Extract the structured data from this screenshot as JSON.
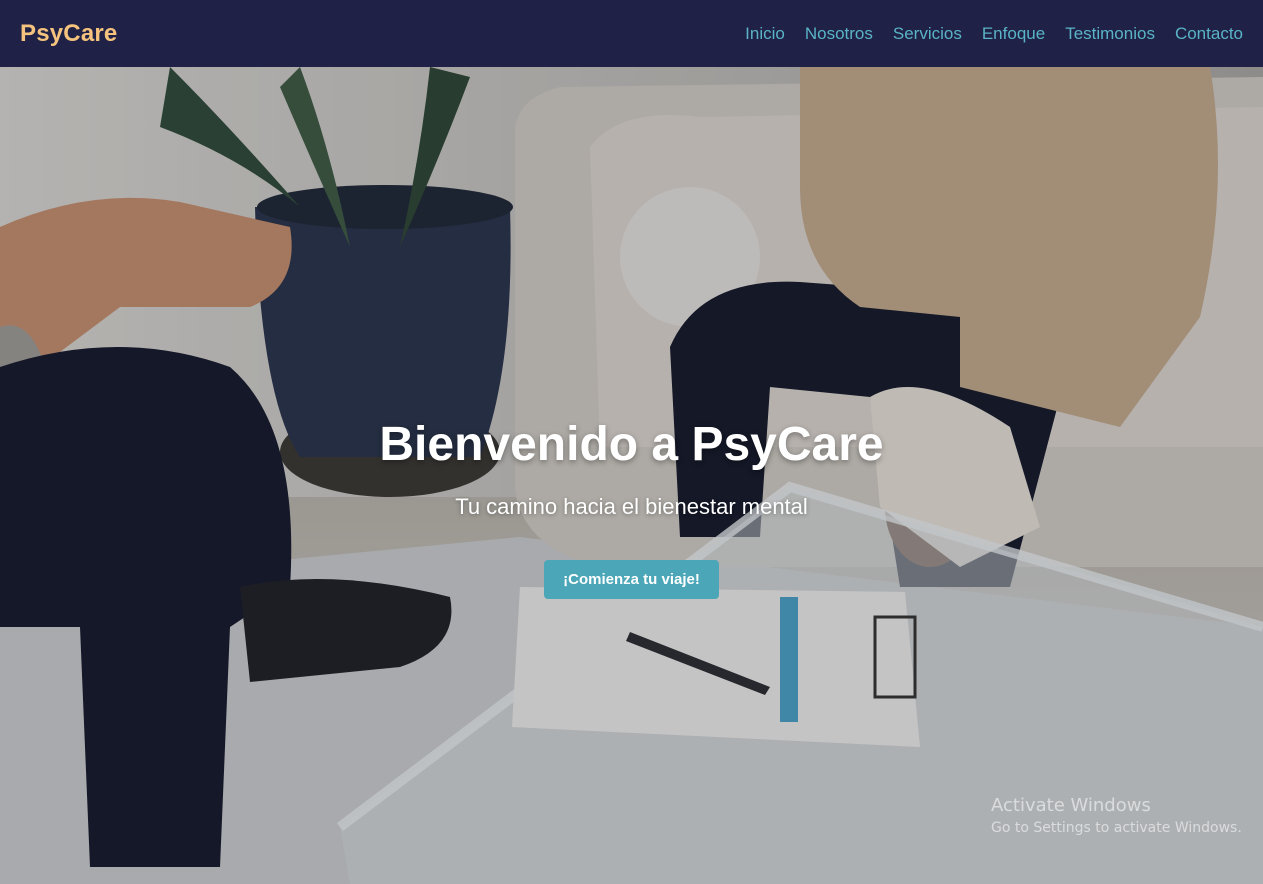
{
  "brand": {
    "name": "PsyCare",
    "color": "#f5c37d"
  },
  "nav": {
    "items": [
      {
        "label": "Inicio"
      },
      {
        "label": "Nosotros"
      },
      {
        "label": "Servicios"
      },
      {
        "label": "Enfoque"
      },
      {
        "label": "Testimonios"
      },
      {
        "label": "Contacto"
      }
    ],
    "link_color": "#5ab3c6",
    "background": "#1f2246"
  },
  "hero": {
    "title": "Bienvenido a PsyCare",
    "subtitle": "Tu camino hacia el bienestar mental",
    "cta_label": "¡Comienza tu viaje!",
    "cta_color": "#4ba6b8"
  },
  "watermark": {
    "title": "Activate Windows",
    "subtitle": "Go to Settings to activate Windows."
  }
}
